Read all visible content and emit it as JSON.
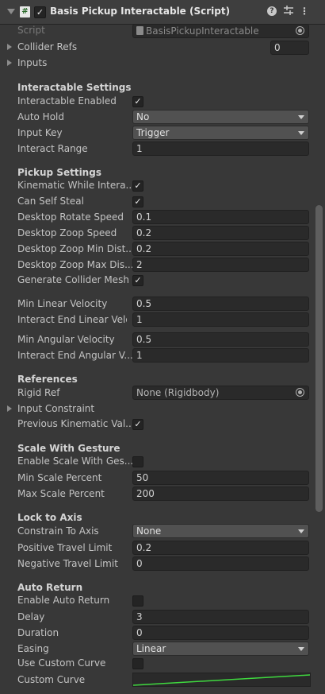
{
  "header": {
    "title": "Basis Pickup Interactable (Script)",
    "script_icon": "#",
    "enabled_check": "✓",
    "icons": [
      "foldout-arrow-icon",
      "script-icon",
      "help-icon",
      "preset-sliders-icon",
      "context-menu-icon"
    ]
  },
  "script": {
    "label": "Script",
    "value": "BasisPickupInteractable"
  },
  "collider_refs": {
    "label": "Collider Refs",
    "count": "0"
  },
  "inputs": {
    "label": "Inputs"
  },
  "interactable": {
    "title": "Interactable Settings",
    "enabled_label": "Interactable Enabled",
    "enabled": "✓",
    "auto_hold_label": "Auto Hold",
    "auto_hold": "No",
    "input_key_label": "Input Key",
    "input_key": "Trigger",
    "range_label": "Interact Range",
    "range": "1"
  },
  "pickup": {
    "title": "Pickup Settings",
    "kinematic_label": "Kinematic While Intera...",
    "kinematic": "✓",
    "self_steal_label": "Can Self Steal",
    "self_steal": "✓",
    "rotate_speed_label": "Desktop Rotate Speed",
    "rotate_speed": "0.1",
    "zoop_speed_label": "Desktop Zoop Speed",
    "zoop_speed": "0.2",
    "zoop_min_label": "Desktop Zoop Min Dist...",
    "zoop_min": "0.2",
    "zoop_max_label": "Desktop Zoop Max Dis...",
    "zoop_max": "2",
    "collider_mesh_label": "Generate Collider Mesh",
    "collider_mesh": "✓",
    "min_linear_label": "Min Linear Velocity",
    "min_linear": "0.5",
    "end_linear_label": "Interact End Linear Velo...",
    "end_linear": "1",
    "min_angular_label": "Min Angular Velocity",
    "min_angular": "0.5",
    "end_angular_label": "Interact End Angular V...",
    "end_angular": "1"
  },
  "references": {
    "title": "References",
    "rigid_label": "Rigid Ref",
    "rigid": "None (Rigidbody)",
    "constraint_label": "Input Constraint",
    "prev_kinematic_label": "Previous Kinematic Val...",
    "prev_kinematic": "✓"
  },
  "scale": {
    "title": "Scale With Gesture",
    "enable_label": "Enable Scale With Ges...",
    "enable": "",
    "min_label": "Min Scale Percent",
    "min": "50",
    "max_label": "Max Scale Percent",
    "max": "200"
  },
  "lock": {
    "title": "Lock to Axis",
    "constrain_label": "Constrain To Axis",
    "constrain": "None",
    "pos_label": "Positive Travel Limit",
    "pos": "0.2",
    "neg_label": "Negative Travel Limit",
    "neg": "0"
  },
  "auto_return": {
    "title": "Auto Return",
    "enable_label": "Enable Auto Return",
    "enable": "",
    "delay_label": "Delay",
    "delay": "3",
    "duration_label": "Duration",
    "duration": "0",
    "easing_label": "Easing",
    "easing": "Linear",
    "use_curve_label": "Use Custom Curve",
    "use_curve": "",
    "curve_label": "Custom Curve"
  },
  "colors": {
    "background": "#383838",
    "field": "#2a2a2a",
    "curve": "#3fd93f"
  }
}
